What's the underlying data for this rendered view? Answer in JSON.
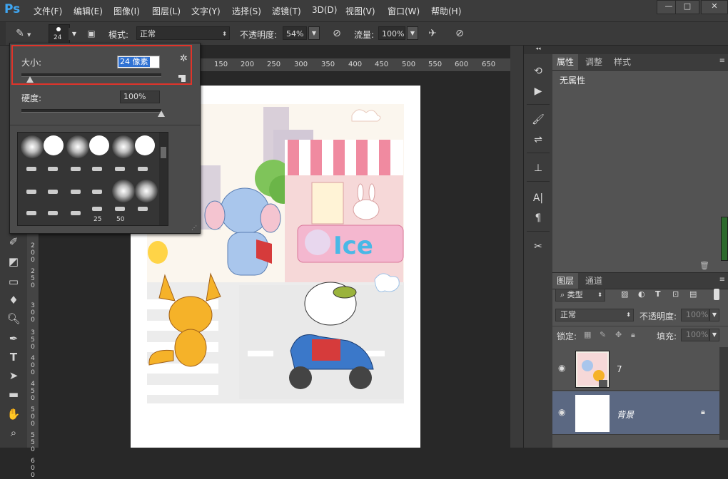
{
  "app": {
    "logo": "Ps"
  },
  "menu": [
    "文件(F)",
    "编辑(E)",
    "图像(I)",
    "图层(L)",
    "文字(Y)",
    "选择(S)",
    "滤镜(T)",
    "3D(D)",
    "视图(V)",
    "窗口(W)",
    "帮助(H)"
  ],
  "window_buttons": [
    "—",
    "□",
    "✕"
  ],
  "options": {
    "brush_size": "24",
    "mode_label": "模式:",
    "mode_value": "正常",
    "opacity_label": "不透明度:",
    "opacity_value": "54%",
    "flow_label": "流量:",
    "flow_value": "100%"
  },
  "brush_popup": {
    "size_label": "大小:",
    "size_value": "24 像素",
    "size_fraction": 0.06,
    "hardness_label": "硬度:",
    "hardness_value": "100%",
    "hardness_fraction": 1.0,
    "preset_numbers": [
      "25",
      "50"
    ]
  },
  "ruler_h": [
    "150",
    "200",
    "250",
    "300",
    "350",
    "400",
    "450",
    "500",
    "550",
    "600",
    "650"
  ],
  "ruler_v": [
    "2\n0\n0",
    "2\n5\n0",
    "3\n0\n0",
    "3\n5\n0",
    "4\n0\n0",
    "4\n5\n0",
    "5\n0\n0",
    "5\n5\n0",
    "6\n0\n0"
  ],
  "properties": {
    "tabs": [
      "属性",
      "调整",
      "样式"
    ],
    "content": "无属性"
  },
  "layers": {
    "tabs": [
      "图层",
      "通道"
    ],
    "filter_value": "类型",
    "blend_mode": "正常",
    "opacity_label": "不透明度:",
    "opacity_value": "100%",
    "lock_label": "锁定:",
    "fill_label": "填充:",
    "fill_value": "100%",
    "items": [
      {
        "name": "7"
      },
      {
        "name": "背景"
      }
    ]
  },
  "colors": {
    "highlight": "#e0342a",
    "selected_layer": "#5b6882",
    "ps_blue": "#3fa6f2"
  }
}
